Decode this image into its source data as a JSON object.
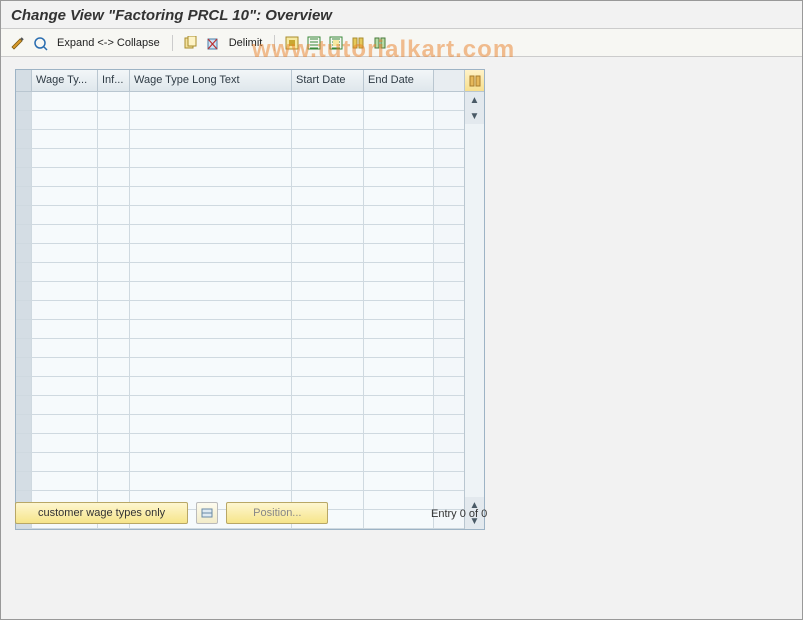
{
  "title": "Change View \"Factoring PRCL 10\": Overview",
  "toolbar": {
    "expand_label": "Expand <-> Collapse",
    "delimit_label": "Delimit"
  },
  "table": {
    "columns": {
      "wage_type": "Wage Ty...",
      "inf": "Inf...",
      "long_text": "Wage Type Long Text",
      "start_date": "Start Date",
      "end_date": "End Date"
    },
    "row_count": 23
  },
  "footer": {
    "customer_btn": "customer wage types only",
    "position_btn": "Position...",
    "entry_text": "Entry 0 of 0"
  },
  "watermark": "www.tutorialkart.com"
}
